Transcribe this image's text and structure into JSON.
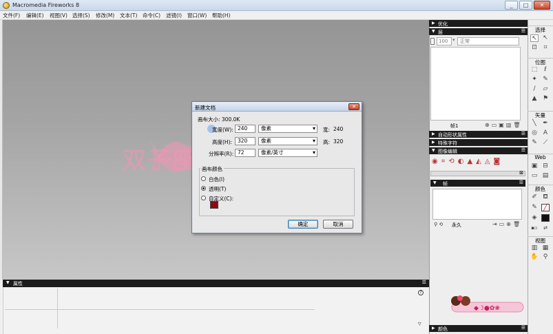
{
  "window": {
    "title": "Macromedia Fireworks 8"
  },
  "menu": [
    "文件(F)",
    "编辑(E)",
    "视图(V)",
    "选择(S)",
    "修改(M)",
    "文本(T)",
    "命令(C)",
    "滤镜(I)",
    "窗口(W)",
    "帮助(H)"
  ],
  "watermark": {
    "text": "双子座的小妖精"
  },
  "dialog": {
    "title": "新建文档",
    "canvas_size": "画布大小: 300.0K",
    "width_label": "宽度(W):",
    "width_value": "240",
    "width_unit": "像素",
    "width_readout_label": "宽:",
    "width_readout": "240",
    "height_label": "高度(H):",
    "height_value": "320",
    "height_unit": "像素",
    "height_readout_label": "高:",
    "height_readout": "320",
    "resolution_label": "分辨率(R):",
    "resolution_value": "72",
    "resolution_unit": "像素/英寸",
    "bg_label": "画布颜色",
    "opt_white": "白色(I)",
    "opt_transparent": "透明(T)",
    "opt_custom": "自定义(C):",
    "selected_bg": "transparent",
    "custom_color": "#8b0a14",
    "ok": "确定",
    "cancel": "取消"
  },
  "properties_panel": {
    "title": "属性"
  },
  "right_panels": {
    "optimize": "优化",
    "layers": "层",
    "layers_opacity": "100",
    "layers_blend": "正常",
    "layers_frame": "帧1",
    "autoshape": "自动形状属性",
    "special_chars": "特殊字符",
    "image_edit": "图像编辑",
    "frames": "帧",
    "frames_forever": "永久",
    "colors": "颜色"
  },
  "tools": {
    "select": "选择",
    "bitmap": "位图",
    "vector": "矢量",
    "web": "Web",
    "colors": "颜色",
    "view": "视图"
  }
}
